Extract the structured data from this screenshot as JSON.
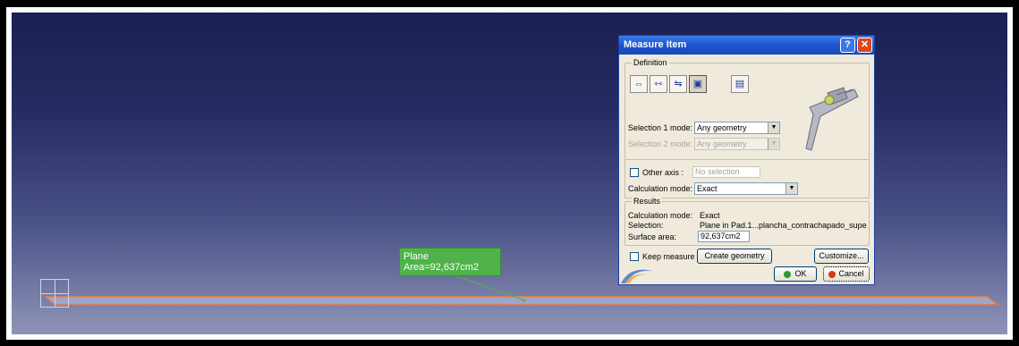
{
  "viewport": {
    "measure_label": {
      "line1": "Plane",
      "line2": "Area=92,637cm2"
    }
  },
  "dialog": {
    "title": "Measure Item",
    "help_glyph": "?",
    "close_glyph": "✕",
    "definition": {
      "group_title": "Definition",
      "icons": [
        "measure-item-icon",
        "measure-between-icon",
        "measure-item-chain-icon",
        "measure-inertia-icon",
        "measure-thickness-icon"
      ],
      "selection1_label": "Selection 1 mode:",
      "selection1_value": "Any geometry",
      "selection2_label": "Selection 2 mode:",
      "selection2_value": "Any geometry",
      "other_axis_label": "Other axis :",
      "other_axis_placeholder": "No selection",
      "calc_mode_label": "Calculation mode:",
      "calc_mode_value": "Exact"
    },
    "results": {
      "group_title": "Results",
      "calc_mode_label": "Calculation mode:",
      "calc_mode_value": "Exact",
      "selection_label": "Selection:",
      "selection_value": "Plane in Pad.1...plancha_contrachapado_supe",
      "surface_label": "Surface area:",
      "surface_value": "92,637cm2"
    },
    "keep_measure_label": "Keep measure",
    "create_geometry_label": "Create geometry",
    "customize_label": "Customize...",
    "ok_label": "OK",
    "cancel_label": "Cancel"
  },
  "colors": {
    "label_bg": "#4fb34a",
    "plane_edge": "#e8733a",
    "title_bar": "#1c55d0"
  }
}
